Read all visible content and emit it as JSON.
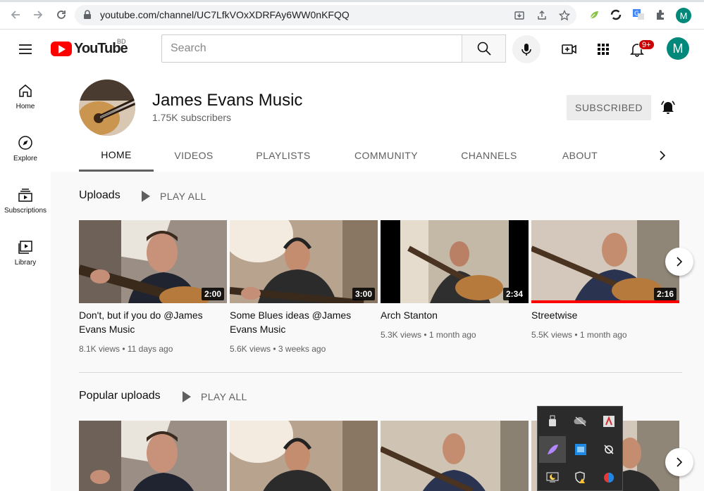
{
  "browser": {
    "url": "youtube.com/channel/UC7LfkVOxXDRFAy6WW0nKFQQ",
    "profile_initial": "M"
  },
  "masthead": {
    "logo_text": "YouTube",
    "country": "BD",
    "search_placeholder": "Search",
    "notification_count": "9+",
    "avatar_initial": "M"
  },
  "leftnav": {
    "items": [
      {
        "label": "Home",
        "icon": "home-icon"
      },
      {
        "label": "Explore",
        "icon": "compass-icon"
      },
      {
        "label": "Subscriptions",
        "icon": "subscriptions-icon"
      },
      {
        "label": "Library",
        "icon": "library-icon"
      }
    ]
  },
  "channel": {
    "name": "James Evans Music",
    "subscribers": "1.75K subscribers",
    "subscribe_label": "SUBSCRIBED",
    "tabs": [
      "HOME",
      "VIDEOS",
      "PLAYLISTS",
      "COMMUNITY",
      "CHANNELS",
      "ABOUT"
    ],
    "active_tab": "HOME"
  },
  "uploads": {
    "title": "Uploads",
    "play_all": "PLAY ALL",
    "videos": [
      {
        "title": "Don't, but if you do @James Evans Music",
        "meta": "8.1K views • 11 days ago",
        "duration": "2:00"
      },
      {
        "title": "Some Blues ideas @James Evans Music",
        "meta": "5.6K views • 3 weeks ago",
        "duration": "3:00"
      },
      {
        "title": "Arch Stanton",
        "meta": "5.3K views • 1 month ago",
        "duration": "2:34"
      },
      {
        "title": "Streetwise",
        "meta": "5.5K views • 1 month ago",
        "duration": "2:16",
        "watched_fraction": 1.0
      }
    ]
  },
  "popular": {
    "title": "Popular uploads",
    "play_all": "PLAY ALL"
  },
  "colors": {
    "brand_red": "#ff0000",
    "avatar_teal": "#00897b",
    "badge_red": "#cc0000"
  }
}
